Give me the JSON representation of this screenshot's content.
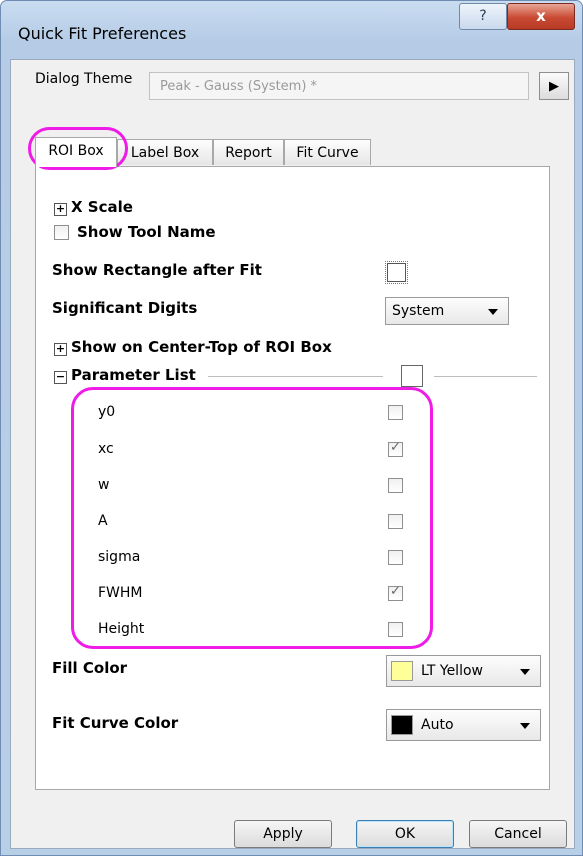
{
  "window": {
    "title": "Quick Fit Preferences",
    "help_glyph": "?",
    "close_glyph": "x"
  },
  "theme": {
    "label": "Dialog Theme",
    "value": "Peak - Gauss (System) *",
    "arrow_glyph": "▶"
  },
  "tabs": [
    {
      "label": "ROI Box",
      "active": true
    },
    {
      "label": "Label Box",
      "active": false
    },
    {
      "label": "Report",
      "active": false
    },
    {
      "label": "Fit Curve",
      "active": false
    }
  ],
  "roi": {
    "x_scale": "X Scale",
    "show_tool_name": "Show Tool Name",
    "show_rectangle": "Show Rectangle after Fit",
    "sig_digits_label": "Significant Digits",
    "sig_digits_value": "System",
    "show_center_top": "Show on Center-Top of ROI Box",
    "parameter_list": "Parameter List",
    "params": [
      {
        "name": "y0",
        "checked": false
      },
      {
        "name": "xc",
        "checked": true
      },
      {
        "name": "w",
        "checked": false
      },
      {
        "name": "A",
        "checked": false
      },
      {
        "name": "sigma",
        "checked": false
      },
      {
        "name": "FWHM",
        "checked": true
      },
      {
        "name": "Height",
        "checked": false
      }
    ],
    "fill_color_label": "Fill Color",
    "fill_color_value": "LT Yellow",
    "fill_color_hex": "#ffff99",
    "fit_curve_color_label": "Fit Curve Color",
    "fit_curve_color_value": "Auto",
    "fit_curve_color_hex": "#000000"
  },
  "buttons": {
    "apply": "Apply",
    "ok": "OK",
    "cancel": "Cancel"
  },
  "colors": {
    "highlight": "#ee1ce6"
  },
  "expand_glyphs": {
    "plus": "+",
    "minus": "−"
  }
}
